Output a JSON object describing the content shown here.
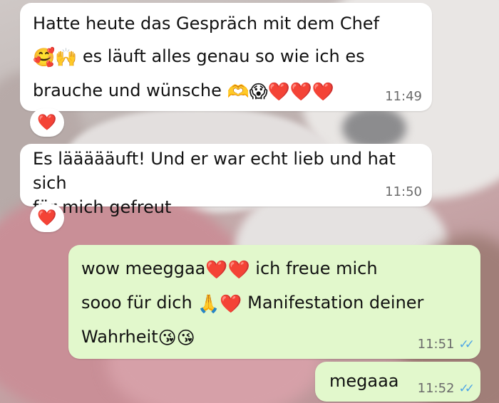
{
  "messages": [
    {
      "direction": "incoming",
      "lines": [
        "Hatte heute das Gespräch mit dem Chef",
        [
          "🥰🙌",
          " es läuft alles genau so wie ich es"
        ],
        [
          "brauche und wünsche ",
          "🫶😱❤️❤️❤️"
        ]
      ],
      "time": "11:49",
      "reaction": "❤️"
    },
    {
      "direction": "incoming",
      "lines": [
        "Es läääääuft! Und er war echt lieb und hat sich",
        "für mich gefreut"
      ],
      "time": "11:50",
      "reaction": "❤️"
    },
    {
      "direction": "outgoing",
      "lines": [
        [
          "wow meeggaa",
          "❤️❤️",
          " ich freue mich"
        ],
        [
          "sooo für dich ",
          "🙏❤️",
          " Manifestation deiner"
        ],
        [
          "Wahrheit",
          "😘😘"
        ]
      ],
      "time": "11:51",
      "status": "read"
    },
    {
      "direction": "outgoing",
      "lines": [
        "megaaa"
      ],
      "time": "11:52",
      "status": "read"
    }
  ],
  "colors": {
    "incoming_bubble": "#ffffff",
    "outgoing_bubble": "#e2f8cc",
    "read_ticks": "#4fa6e6",
    "reaction_heart": "#e0243a"
  },
  "icons": {
    "read_status": "double-check-icon"
  }
}
